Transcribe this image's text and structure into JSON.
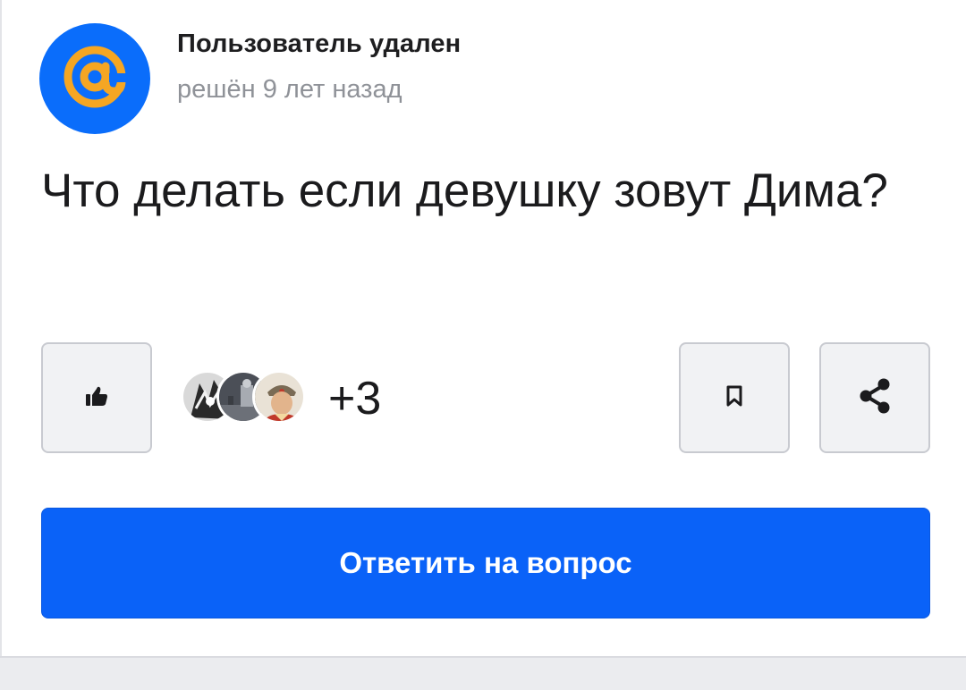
{
  "colors": {
    "brand": "#0a62f8",
    "avatar_bg": "#0a6dfb",
    "avatar_glyph": "#f5a623",
    "muted_text": "#8f9298"
  },
  "author": {
    "name": "Пользователь удален",
    "meta": "решён 9 лет назад",
    "avatar_icon": "mail-ru-at-logo-icon"
  },
  "question": {
    "title": "Что делать если девушку зовут Дима?"
  },
  "actions": {
    "like_icon": "thumbs-up-icon",
    "likes_extra": "+3",
    "bookmark_icon": "bookmark-icon",
    "share_icon": "share-icon",
    "answer_label": "Ответить на вопрос"
  }
}
